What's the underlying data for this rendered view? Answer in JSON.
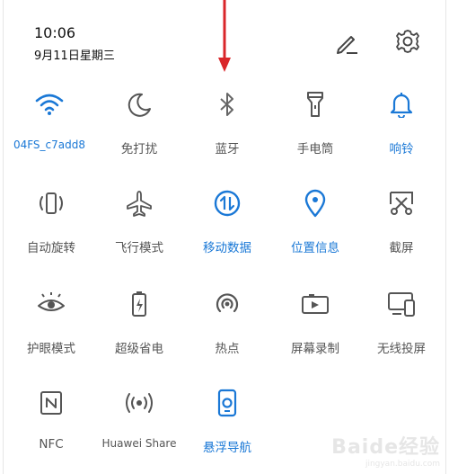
{
  "status": {
    "time": "10:06",
    "date": "9月11日星期三"
  },
  "header_icons": {
    "edit": "edit-pencil-icon",
    "settings": "gear-icon"
  },
  "accent_color": "#1a78d6",
  "annotation_color": "#d9262a",
  "tiles": [
    {
      "label": "04FS_c7add8",
      "icon": "wifi-icon",
      "active": true
    },
    {
      "label": "免打扰",
      "icon": "moon-icon",
      "active": false
    },
    {
      "label": "蓝牙",
      "icon": "bluetooth-icon",
      "active": false
    },
    {
      "label": "手电筒",
      "icon": "flashlight-icon",
      "active": false
    },
    {
      "label": "响铃",
      "icon": "bell-icon",
      "active": true
    },
    {
      "label": "自动旋转",
      "icon": "rotate-icon",
      "active": false
    },
    {
      "label": "飞行模式",
      "icon": "airplane-icon",
      "active": false
    },
    {
      "label": "移动数据",
      "icon": "mobile-data-icon",
      "active": true
    },
    {
      "label": "位置信息",
      "icon": "location-icon",
      "active": true
    },
    {
      "label": "截屏",
      "icon": "screenshot-icon",
      "active": false
    },
    {
      "label": "护眼模式",
      "icon": "eye-icon",
      "active": false
    },
    {
      "label": "超级省电",
      "icon": "battery-saver-icon",
      "active": false
    },
    {
      "label": "热点",
      "icon": "hotspot-icon",
      "active": false
    },
    {
      "label": "屏幕录制",
      "icon": "screen-record-icon",
      "active": false
    },
    {
      "label": "无线投屏",
      "icon": "wireless-projection-icon",
      "active": false
    },
    {
      "label": "NFC",
      "icon": "nfc-icon",
      "active": false
    },
    {
      "label": "Huawei Share",
      "icon": "huawei-share-icon",
      "active": false
    },
    {
      "label": "悬浮导航",
      "icon": "floating-nav-icon",
      "active": true
    }
  ],
  "watermark": {
    "text": "Baide经验",
    "sub": "jingyan.baidu.com"
  }
}
